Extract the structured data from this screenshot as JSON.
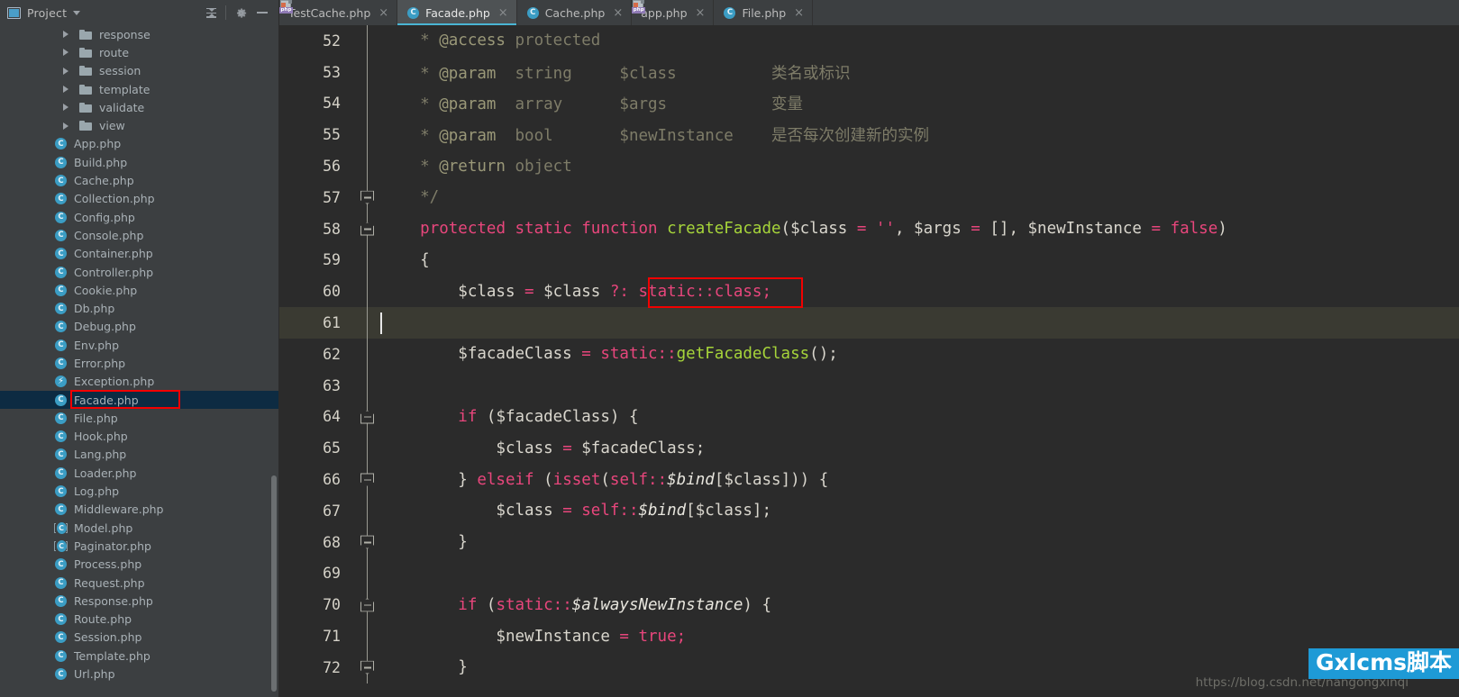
{
  "project_panel": {
    "title": "Project",
    "icon": "project-icon",
    "caret": "chevron-down-icon",
    "buttons": [
      {
        "name": "collapse-all-button",
        "icon": "collapse-all-icon"
      },
      {
        "name": "settings-button",
        "icon": "gear-icon"
      },
      {
        "name": "hide-panel-button",
        "icon": "minimize-icon"
      }
    ],
    "tree": [
      {
        "label": "response",
        "kind": "folder",
        "expandable": true
      },
      {
        "label": "route",
        "kind": "folder",
        "expandable": true
      },
      {
        "label": "session",
        "kind": "folder",
        "expandable": true
      },
      {
        "label": "template",
        "kind": "folder",
        "expandable": true
      },
      {
        "label": "validate",
        "kind": "folder",
        "expandable": true
      },
      {
        "label": "view",
        "kind": "folder",
        "expandable": true
      },
      {
        "label": "App.php",
        "kind": "class"
      },
      {
        "label": "Build.php",
        "kind": "class"
      },
      {
        "label": "Cache.php",
        "kind": "class"
      },
      {
        "label": "Collection.php",
        "kind": "class"
      },
      {
        "label": "Config.php",
        "kind": "class"
      },
      {
        "label": "Console.php",
        "kind": "class"
      },
      {
        "label": "Container.php",
        "kind": "class"
      },
      {
        "label": "Controller.php",
        "kind": "class"
      },
      {
        "label": "Cookie.php",
        "kind": "class"
      },
      {
        "label": "Db.php",
        "kind": "class"
      },
      {
        "label": "Debug.php",
        "kind": "class"
      },
      {
        "label": "Env.php",
        "kind": "class"
      },
      {
        "label": "Error.php",
        "kind": "class"
      },
      {
        "label": "Exception.php",
        "kind": "exception"
      },
      {
        "label": "Facade.php",
        "kind": "class",
        "selected": true,
        "highlighted": true
      },
      {
        "label": "File.php",
        "kind": "class"
      },
      {
        "label": "Hook.php",
        "kind": "class"
      },
      {
        "label": "Lang.php",
        "kind": "class"
      },
      {
        "label": "Loader.php",
        "kind": "class"
      },
      {
        "label": "Log.php",
        "kind": "class"
      },
      {
        "label": "Middleware.php",
        "kind": "class"
      },
      {
        "label": "Model.php",
        "kind": "abstract"
      },
      {
        "label": "Paginator.php",
        "kind": "abstract"
      },
      {
        "label": "Process.php",
        "kind": "class"
      },
      {
        "label": "Request.php",
        "kind": "class"
      },
      {
        "label": "Response.php",
        "kind": "class"
      },
      {
        "label": "Route.php",
        "kind": "class"
      },
      {
        "label": "Session.php",
        "kind": "class"
      },
      {
        "label": "Template.php",
        "kind": "class"
      },
      {
        "label": "Url.php",
        "kind": "class"
      }
    ]
  },
  "tabs": [
    {
      "label": "TestCache.php",
      "kind": "php",
      "active": false,
      "close": "×"
    },
    {
      "label": "Facade.php",
      "kind": "class",
      "active": true,
      "close": "×"
    },
    {
      "label": "Cache.php",
      "kind": "class",
      "active": false,
      "close": "×"
    },
    {
      "label": "app.php",
      "kind": "php",
      "active": false,
      "close": "×"
    },
    {
      "label": "File.php",
      "kind": "class",
      "active": false,
      "close": "×"
    }
  ],
  "editor": {
    "first_line": 52,
    "caret_line": 61,
    "lines": [
      {
        "num": "52",
        "fold": "",
        "tokens": [
          {
            "t": "    * ",
            "c": "c-cmt"
          },
          {
            "t": "@access",
            "c": "c-cmtt"
          },
          {
            "t": " protected",
            "c": "c-cmt"
          }
        ]
      },
      {
        "num": "53",
        "fold": "",
        "tokens": [
          {
            "t": "    * ",
            "c": "c-cmt"
          },
          {
            "t": "@param",
            "c": "c-cmtt"
          },
          {
            "t": "  string     $class          类名或标识",
            "c": "c-cmt"
          }
        ]
      },
      {
        "num": "54",
        "fold": "",
        "tokens": [
          {
            "t": "    * ",
            "c": "c-cmt"
          },
          {
            "t": "@param",
            "c": "c-cmtt"
          },
          {
            "t": "  array      $args           变量",
            "c": "c-cmt"
          }
        ]
      },
      {
        "num": "55",
        "fold": "",
        "tokens": [
          {
            "t": "    * ",
            "c": "c-cmt"
          },
          {
            "t": "@param",
            "c": "c-cmtt"
          },
          {
            "t": "  bool       $newInstance    是否每次创建新的实例",
            "c": "c-cmt"
          }
        ]
      },
      {
        "num": "56",
        "fold": "",
        "tokens": [
          {
            "t": "    * ",
            "c": "c-cmt"
          },
          {
            "t": "@return",
            "c": "c-cmtt"
          },
          {
            "t": " object",
            "c": "c-cmt"
          }
        ]
      },
      {
        "num": "57",
        "fold": "end",
        "tokens": [
          {
            "t": "    */",
            "c": "c-cmt"
          }
        ]
      },
      {
        "num": "58",
        "fold": "start",
        "tokens": [
          {
            "t": "    ",
            "c": "c-txt"
          },
          {
            "t": "protected static function ",
            "c": "c-kw"
          },
          {
            "t": "createFacade",
            "c": "c-fn"
          },
          {
            "t": "(",
            "c": "c-txt"
          },
          {
            "t": "$class",
            "c": "c-txt"
          },
          {
            "t": " = ",
            "c": "c-kw"
          },
          {
            "t": "''",
            "c": "c-str"
          },
          {
            "t": ", $args",
            "c": "c-txt"
          },
          {
            "t": " = ",
            "c": "c-kw"
          },
          {
            "t": "[]",
            "c": "c-txt"
          },
          {
            "t": ", $newInstance",
            "c": "c-txt"
          },
          {
            "t": " = ",
            "c": "c-kw"
          },
          {
            "t": "false",
            "c": "c-kw"
          },
          {
            "t": ")",
            "c": "c-txt"
          }
        ]
      },
      {
        "num": "59",
        "fold": "",
        "tokens": [
          {
            "t": "    {",
            "c": "c-txt"
          }
        ]
      },
      {
        "num": "60",
        "fold": "",
        "tokens": [
          {
            "t": "        $class ",
            "c": "c-txt"
          },
          {
            "t": "= ",
            "c": "c-kw"
          },
          {
            "t": "$class ",
            "c": "c-txt"
          },
          {
            "t": "?: ",
            "c": "c-kw"
          },
          {
            "t": "static::class;",
            "c": "c-kw"
          }
        ]
      },
      {
        "num": "61",
        "fold": "",
        "tokens": [
          {
            "t": "",
            "c": "c-txt"
          }
        ]
      },
      {
        "num": "62",
        "fold": "",
        "tokens": [
          {
            "t": "        $facadeClass ",
            "c": "c-txt"
          },
          {
            "t": "= ",
            "c": "c-kw"
          },
          {
            "t": "static::",
            "c": "c-kw"
          },
          {
            "t": "getFacadeClass",
            "c": "c-fn"
          },
          {
            "t": "();",
            "c": "c-txt"
          }
        ]
      },
      {
        "num": "63",
        "fold": "",
        "tokens": [
          {
            "t": "",
            "c": "c-txt"
          }
        ]
      },
      {
        "num": "64",
        "fold": "start",
        "tokens": [
          {
            "t": "        ",
            "c": "c-txt"
          },
          {
            "t": "if ",
            "c": "c-kw"
          },
          {
            "t": "($facadeClass) {",
            "c": "c-txt"
          }
        ]
      },
      {
        "num": "65",
        "fold": "",
        "tokens": [
          {
            "t": "            $class ",
            "c": "c-txt"
          },
          {
            "t": "= ",
            "c": "c-kw"
          },
          {
            "t": "$facadeClass;",
            "c": "c-txt"
          }
        ]
      },
      {
        "num": "66",
        "fold": "end",
        "tokens": [
          {
            "t": "        } ",
            "c": "c-txt"
          },
          {
            "t": "elseif ",
            "c": "c-kw"
          },
          {
            "t": "(",
            "c": "c-txt"
          },
          {
            "t": "isset",
            "c": "c-kw"
          },
          {
            "t": "(",
            "c": "c-txt"
          },
          {
            "t": "self::",
            "c": "c-kw"
          },
          {
            "t": "$bind",
            "c": "c-fld"
          },
          {
            "t": "[$class])) {",
            "c": "c-txt"
          }
        ]
      },
      {
        "num": "67",
        "fold": "",
        "tokens": [
          {
            "t": "            $class ",
            "c": "c-txt"
          },
          {
            "t": "= ",
            "c": "c-kw"
          },
          {
            "t": "self::",
            "c": "c-kw"
          },
          {
            "t": "$bind",
            "c": "c-fld"
          },
          {
            "t": "[$class];",
            "c": "c-txt"
          }
        ]
      },
      {
        "num": "68",
        "fold": "end",
        "tokens": [
          {
            "t": "        }",
            "c": "c-txt"
          }
        ]
      },
      {
        "num": "69",
        "fold": "",
        "tokens": [
          {
            "t": "",
            "c": "c-txt"
          }
        ]
      },
      {
        "num": "70",
        "fold": "start",
        "tokens": [
          {
            "t": "        ",
            "c": "c-txt"
          },
          {
            "t": "if ",
            "c": "c-kw"
          },
          {
            "t": "(",
            "c": "c-txt"
          },
          {
            "t": "static::",
            "c": "c-kw"
          },
          {
            "t": "$alwaysNewInstance",
            "c": "c-fld"
          },
          {
            "t": ") {",
            "c": "c-txt"
          }
        ]
      },
      {
        "num": "71",
        "fold": "",
        "tokens": [
          {
            "t": "            $newInstance ",
            "c": "c-txt"
          },
          {
            "t": "= ",
            "c": "c-kw"
          },
          {
            "t": "true;",
            "c": "c-kw"
          }
        ]
      },
      {
        "num": "72",
        "fold": "end",
        "tokens": [
          {
            "t": "        }",
            "c": "c-txt"
          }
        ]
      }
    ],
    "annotation": {
      "name": "red-highlight-box",
      "target": "static::class;"
    }
  },
  "watermark": {
    "url": "https://blog.csdn.net/nangongxinqi",
    "badge": "Gxlcms脚本"
  },
  "colors": {
    "accent": "#4ab5d4",
    "sidebar_bg": "#3c3f41",
    "editor_bg": "#2b2b2b",
    "selection_bg": "#0d2b42",
    "highlight_red": "#f20000",
    "badge_blue": "#1e9ad6",
    "keyword": "#e8467c",
    "function": "#a6d43a",
    "comment": "#7e7c68"
  }
}
